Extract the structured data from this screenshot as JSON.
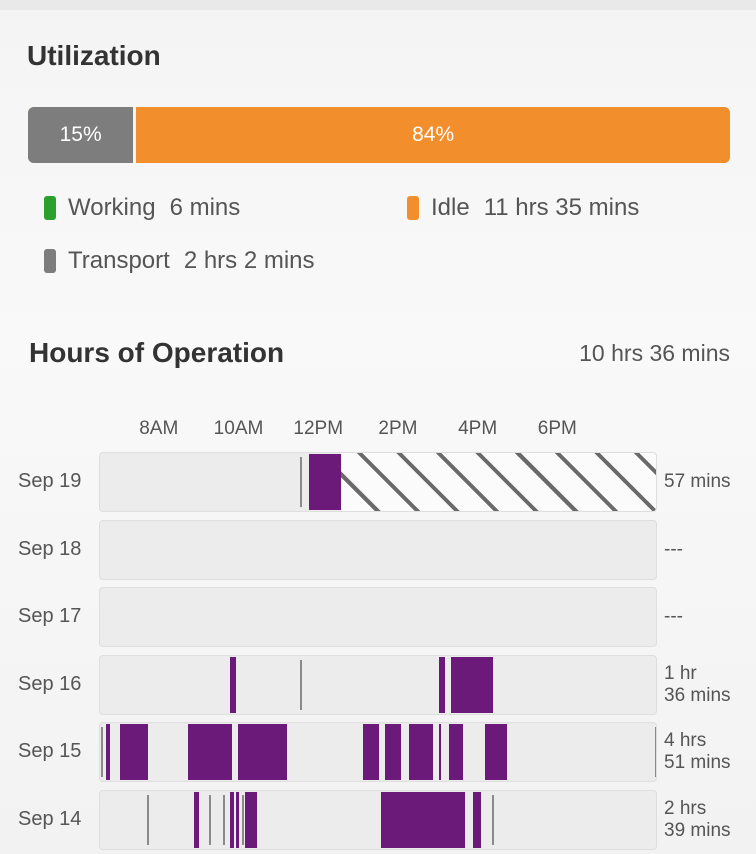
{
  "utilization": {
    "title": "Utilization",
    "bar": {
      "transport_percent": 15,
      "transport_label": "15%",
      "working_percent": 1,
      "idle_percent": 84,
      "idle_label": "84%"
    },
    "legend": [
      {
        "key": "working",
        "label": "Working",
        "value": "6 mins",
        "color": "#2ca02c"
      },
      {
        "key": "idle",
        "label": "Idle",
        "value": "11 hrs 35 mins",
        "color": "#f28e2b"
      },
      {
        "key": "transport",
        "label": "Transport",
        "value": "2 hrs 2 mins",
        "color": "#7d7d7d"
      }
    ]
  },
  "hours": {
    "title": "Hours of Operation",
    "total": "10 hrs 36 mins",
    "axis_hours_start": 6.5,
    "axis_hours_end": 20.5,
    "ticks": [
      {
        "label": "8AM",
        "hour": 8
      },
      {
        "label": "10AM",
        "hour": 10
      },
      {
        "label": "12PM",
        "hour": 12
      },
      {
        "label": "2PM",
        "hour": 14
      },
      {
        "label": "4PM",
        "hour": 16
      },
      {
        "label": "6PM",
        "hour": 18
      }
    ],
    "rows": [
      {
        "date": "Sep 19",
        "total_line1": "57 mins",
        "total_line2": "",
        "no_data_after_hour": 12.55,
        "blocks": [
          [
            11.75,
            12.55
          ]
        ],
        "lines": [
          11.55
        ]
      },
      {
        "date": "Sep 18",
        "total_line1": "---",
        "total_line2": "",
        "blocks": [],
        "lines": []
      },
      {
        "date": "Sep 17",
        "total_line1": "---",
        "total_line2": "",
        "blocks": [],
        "lines": []
      },
      {
        "date": "Sep 16",
        "total_line1": "1 hr",
        "total_line2": "36 mins",
        "blocks": [
          [
            9.75,
            9.9
          ],
          [
            15.0,
            15.15
          ],
          [
            15.3,
            16.35
          ]
        ],
        "lines": [
          11.55
        ]
      },
      {
        "date": "Sep 15",
        "total_line1": "4 hrs",
        "total_line2": "51 mins",
        "blocks": [
          [
            6.65,
            6.75
          ],
          [
            7.0,
            7.7
          ],
          [
            8.7,
            9.8
          ],
          [
            9.95,
            11.2
          ],
          [
            13.1,
            13.5
          ],
          [
            13.65,
            14.05
          ],
          [
            14.25,
            14.85
          ],
          [
            15.0,
            15.05
          ],
          [
            15.25,
            15.6
          ],
          [
            16.15,
            16.7
          ]
        ],
        "lines": [
          6.55,
          20.45
        ]
      },
      {
        "date": "Sep 14",
        "total_line1": "2 hrs",
        "total_line2": "39 mins",
        "blocks": [
          [
            8.85,
            8.98
          ],
          [
            9.75,
            9.85
          ],
          [
            9.92,
            10.0
          ],
          [
            10.15,
            10.45
          ],
          [
            13.55,
            15.65
          ],
          [
            15.85,
            16.05
          ]
        ],
        "lines": [
          7.7,
          9.25,
          9.6,
          10.1,
          16.35
        ]
      }
    ]
  }
}
